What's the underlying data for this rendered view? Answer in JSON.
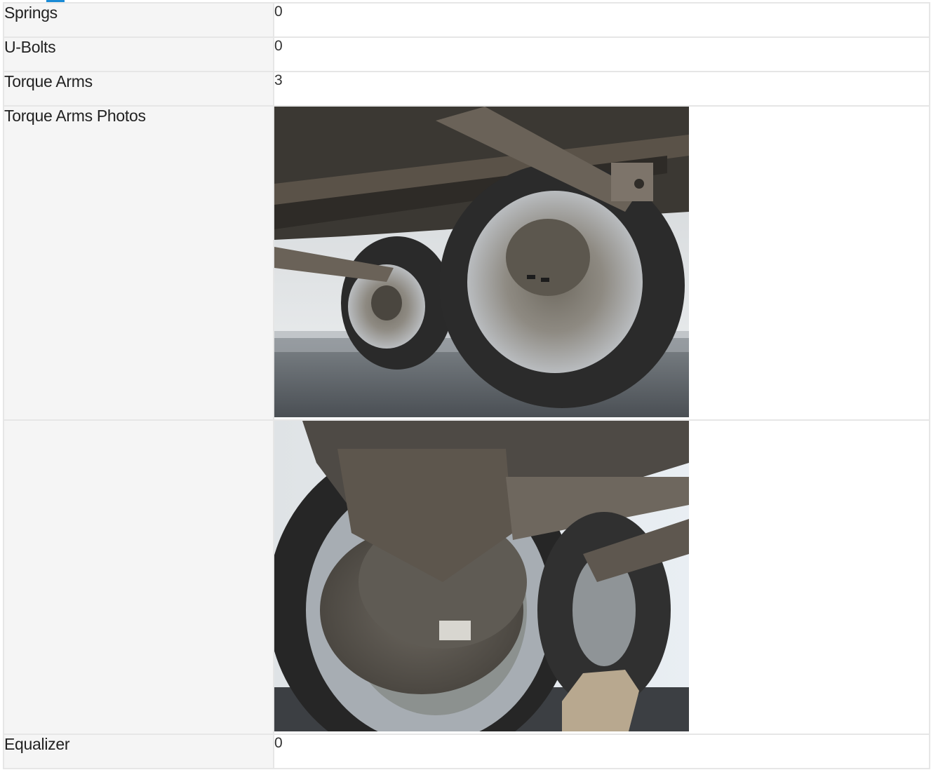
{
  "rows": [
    {
      "label": "Springs",
      "value": "0"
    },
    {
      "label": "U-Bolts",
      "value": "0"
    },
    {
      "label": "Torque Arms",
      "value": "3"
    },
    {
      "label": "Torque Arms Photos"
    },
    {
      "label": ""
    },
    {
      "label": "Equalizer",
      "value": "0"
    }
  ],
  "photos": [
    {
      "name": "trailer-undercarriage-photo-1"
    },
    {
      "name": "trailer-undercarriage-photo-2"
    }
  ],
  "colors": {
    "accent": "#1a8bd6",
    "label_bg": "#f5f5f5",
    "border": "#e6e6e6"
  }
}
